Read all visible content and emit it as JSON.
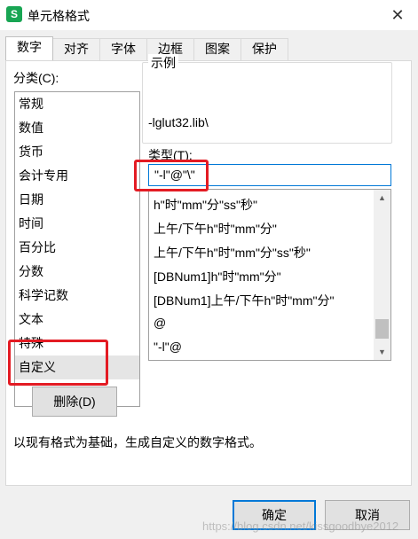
{
  "window": {
    "app_icon_glyph": "S",
    "title": "单元格格式",
    "close_glyph": "✕"
  },
  "tabs": [
    {
      "label": "数字",
      "active": true
    },
    {
      "label": "对齐",
      "active": false
    },
    {
      "label": "字体",
      "active": false
    },
    {
      "label": "边框",
      "active": false
    },
    {
      "label": "图案",
      "active": false
    },
    {
      "label": "保护",
      "active": false
    }
  ],
  "category": {
    "label": "分类(C):",
    "items": [
      "常规",
      "数值",
      "货币",
      "会计专用",
      "日期",
      "时间",
      "百分比",
      "分数",
      "科学记数",
      "文本",
      "特殊",
      "自定义"
    ],
    "selected": "自定义"
  },
  "sample": {
    "label": "示例",
    "value": "-lglut32.lib\\"
  },
  "type": {
    "label": "类型(T):",
    "value": "\"-l\"@\"\\\""
  },
  "format_list": {
    "items": [
      "h\"时\"mm\"分\"ss\"秒\"",
      "上午/下午h\"时\"mm\"分\"",
      "上午/下午h\"时\"mm\"分\"ss\"秒\"",
      "[DBNum1]h\"时\"mm\"分\"",
      "[DBNum1]上午/下午h\"时\"mm\"分\"",
      "@",
      "\"-l\"@"
    ],
    "scroll_up_glyph": "▲",
    "scroll_down_glyph": "▼"
  },
  "delete_button": "删除(D)",
  "description": "以现有格式为基础，生成自定义的数字格式。",
  "footer": {
    "ok_label": "确定",
    "cancel_label": "取消"
  },
  "watermark": "https://blog.csdn.net/kissgoodbye2012",
  "colors": {
    "highlight": "#e31b23",
    "focus_border": "#0078d7",
    "app_icon": "#18a553"
  }
}
